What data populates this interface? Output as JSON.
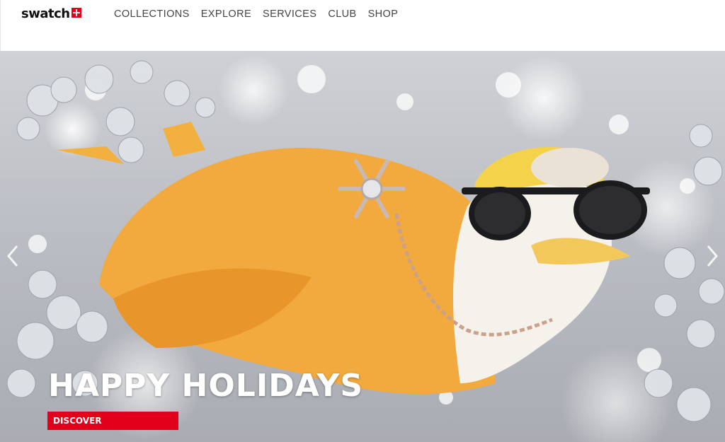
{
  "brand": {
    "logo_text": "swatch"
  },
  "nav": {
    "items": [
      {
        "label": "COLLECTIONS"
      },
      {
        "label": "EXPLORE"
      },
      {
        "label": "SERVICES"
      },
      {
        "label": "CLUB"
      },
      {
        "label": "SHOP"
      }
    ]
  },
  "hero": {
    "headline": "HAPPY HOLIDAYS",
    "cta_label": "DISCOVER",
    "prev_icon": "chevron-left-icon",
    "next_icon": "chevron-right-icon"
  },
  "colors": {
    "brand_red": "#e2001a",
    "nav_text": "#444444",
    "headline": "#ffffff"
  }
}
